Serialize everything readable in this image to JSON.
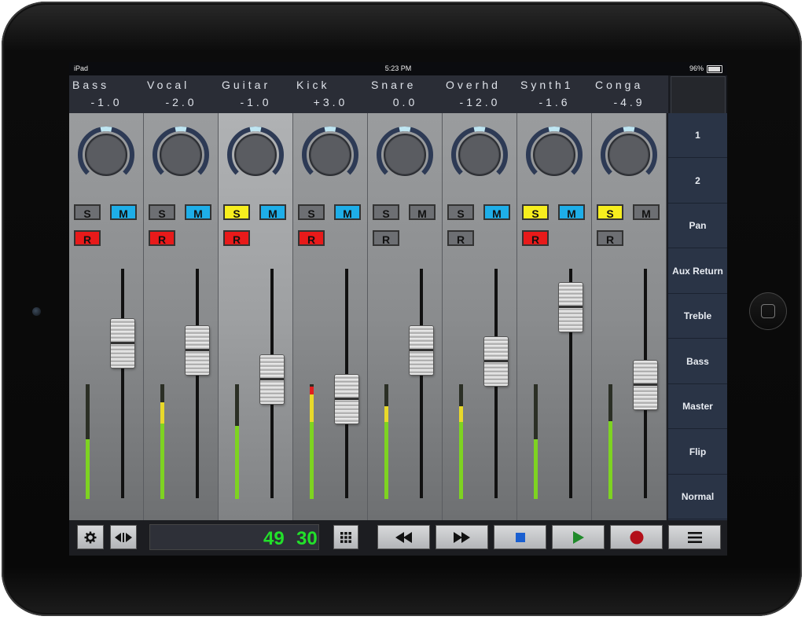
{
  "status": {
    "device": "iPad",
    "time": "5:23 PM",
    "battery": "96%"
  },
  "channels": [
    {
      "name": "Bass",
      "value": "-1.0",
      "solo_on": false,
      "mute_on": true,
      "rec_on": true,
      "fader": 0.68,
      "meter": {
        "green": 0.52,
        "yellow": 0.0,
        "red": 0.0
      },
      "pan": 0.15,
      "selected": false
    },
    {
      "name": "Vocal",
      "value": "-2.0",
      "solo_on": false,
      "mute_on": true,
      "rec_on": true,
      "fader": 0.64,
      "meter": {
        "green": 0.66,
        "yellow": 0.18,
        "red": 0.0
      },
      "pan": 0.15,
      "selected": false
    },
    {
      "name": "Guitar",
      "value": "-1.0",
      "solo_on": true,
      "mute_on": true,
      "rec_on": true,
      "fader": 0.48,
      "meter": {
        "green": 0.64,
        "yellow": 0.0,
        "red": 0.0
      },
      "pan": 0.15,
      "selected": true
    },
    {
      "name": "Kick",
      "value": "+3.0",
      "solo_on": false,
      "mute_on": true,
      "rec_on": true,
      "fader": 0.37,
      "meter": {
        "green": 0.67,
        "yellow": 0.24,
        "red": 0.07
      },
      "pan": 0.15,
      "selected": false
    },
    {
      "name": "Snare",
      "value": "0.0",
      "solo_on": false,
      "mute_on": false,
      "rec_on": false,
      "fader": 0.64,
      "meter": {
        "green": 0.67,
        "yellow": 0.14,
        "red": 0.0
      },
      "pan": 0.15,
      "selected": false
    },
    {
      "name": "Overhd",
      "value": "-12.0",
      "solo_on": false,
      "mute_on": true,
      "rec_on": false,
      "fader": 0.58,
      "meter": {
        "green": 0.67,
        "yellow": 0.14,
        "red": 0.0
      },
      "pan": 0.15,
      "selected": false
    },
    {
      "name": "Synth1",
      "value": "-1.6",
      "solo_on": true,
      "mute_on": true,
      "rec_on": true,
      "fader": 0.88,
      "meter": {
        "green": 0.52,
        "yellow": 0.0,
        "red": 0.0
      },
      "pan": 0.15,
      "selected": false
    },
    {
      "name": "Conga",
      "value": "-4.9",
      "solo_on": true,
      "mute_on": false,
      "rec_on": false,
      "fader": 0.45,
      "meter": {
        "green": 0.68,
        "yellow": 0.0,
        "red": 0.0
      },
      "pan": 0.15,
      "selected": false
    }
  ],
  "labels": {
    "solo": "S",
    "mute": "M",
    "rec": "R"
  },
  "sidebar": [
    "1",
    "2",
    "Pan",
    "Aux Return",
    "Treble",
    "Bass",
    "Master",
    "Flip",
    "Normal"
  ],
  "counter": {
    "a": "49",
    "b": "30"
  },
  "colors": {
    "meter_green": "#7ed321",
    "meter_yellow": "#e8d92a",
    "meter_red": "#e02020",
    "counter": "#22e02a",
    "knob_ring": "#2d3a55",
    "knob_mark": "#bfe6f2"
  }
}
